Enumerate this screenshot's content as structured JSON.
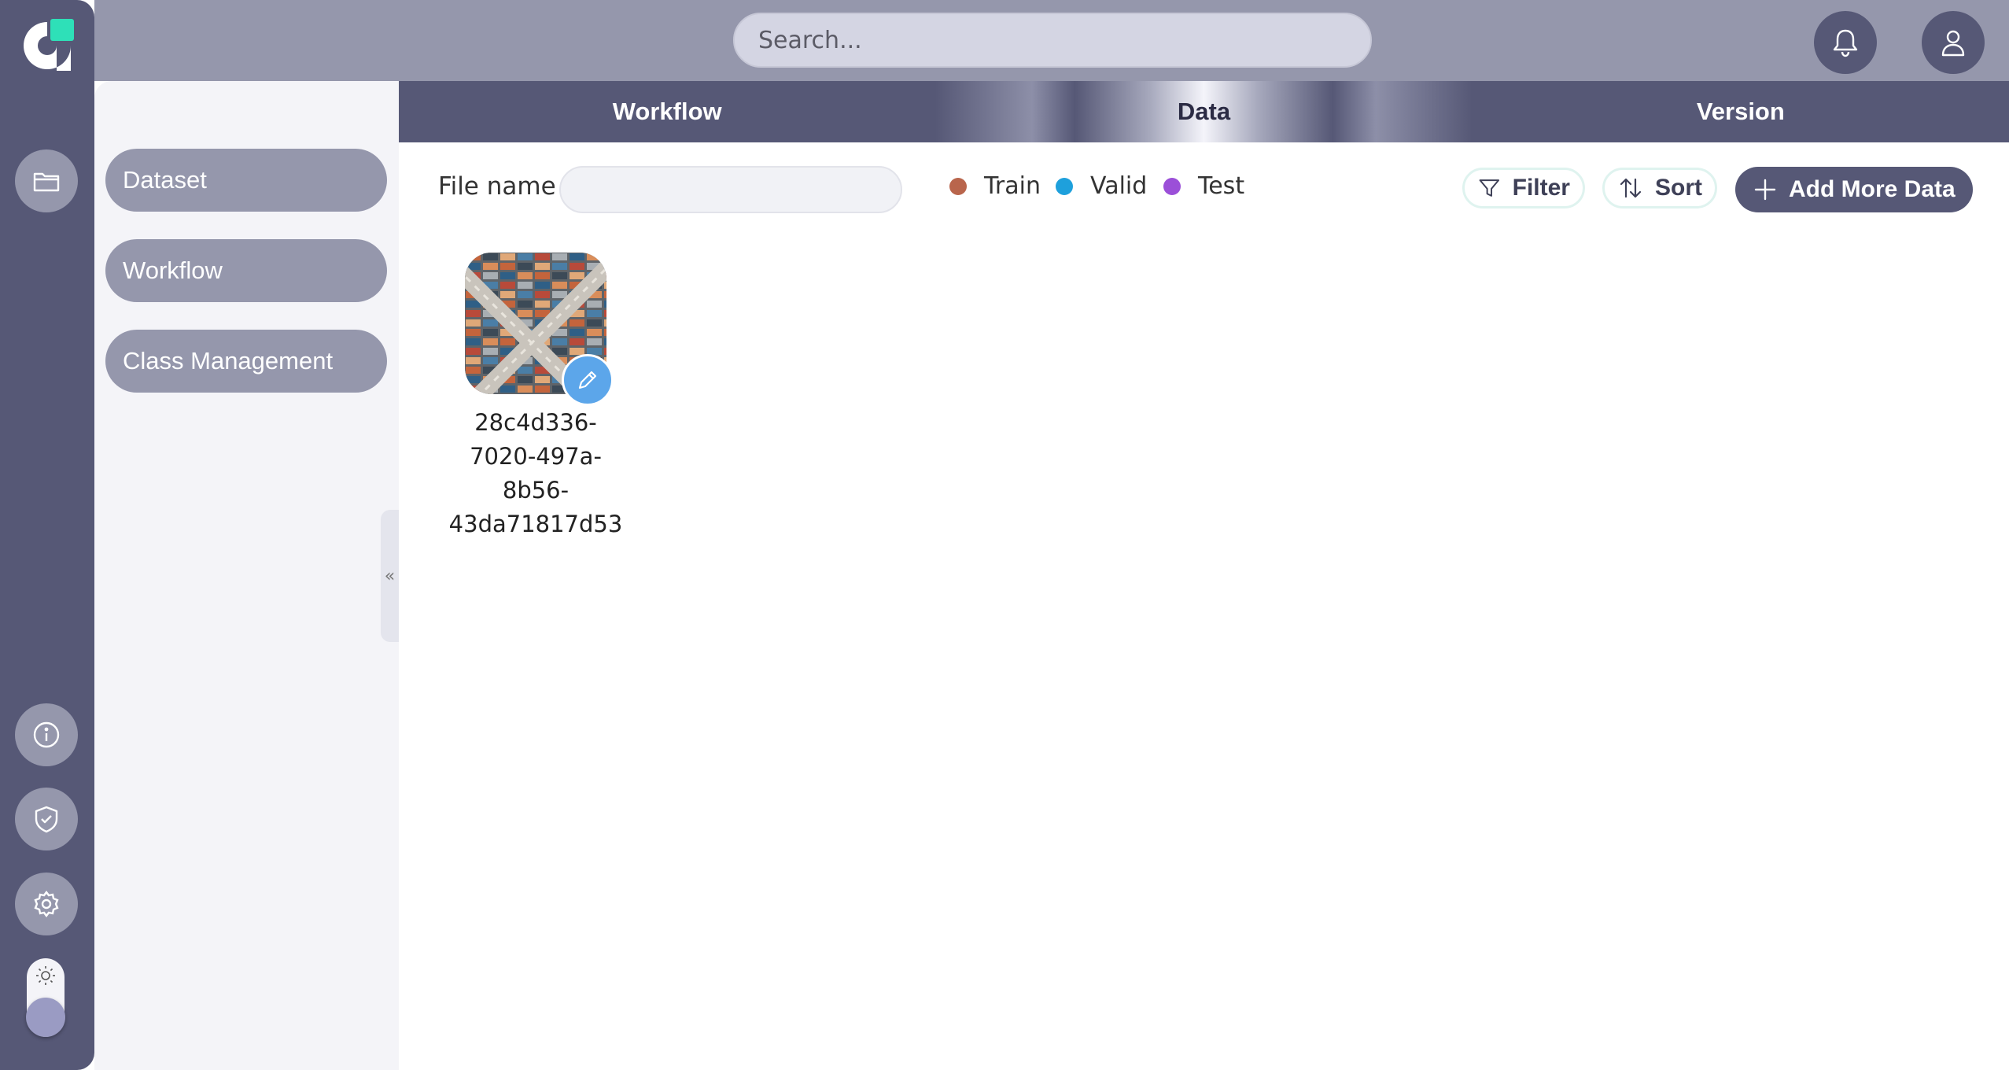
{
  "header": {
    "search_placeholder": "Search..."
  },
  "sidebar": {
    "items": [
      {
        "label": "Dataset"
      },
      {
        "label": "Workflow"
      },
      {
        "label": "Class Management"
      }
    ]
  },
  "tabs": [
    {
      "label": "Workflow",
      "active": false
    },
    {
      "label": "Data",
      "active": true
    },
    {
      "label": "Version",
      "active": false
    }
  ],
  "toolbar": {
    "file_name_label": "File name",
    "file_name_value": "",
    "legend": [
      {
        "label": "Train",
        "color": "#b9654c"
      },
      {
        "label": "Valid",
        "color": "#1ea0dc"
      },
      {
        "label": "Test",
        "color": "#9b4fd8"
      }
    ],
    "filter_label": "Filter",
    "sort_label": "Sort",
    "add_label": "Add More Data"
  },
  "files": [
    {
      "name": "28c4d336-7020-497a-8b56-43da71817d53"
    }
  ],
  "colors": {
    "rail": "#565876",
    "accent_light": "#9597ac",
    "logo_accent": "#2ee0b8",
    "edit_badge": "#5ca6ea"
  }
}
